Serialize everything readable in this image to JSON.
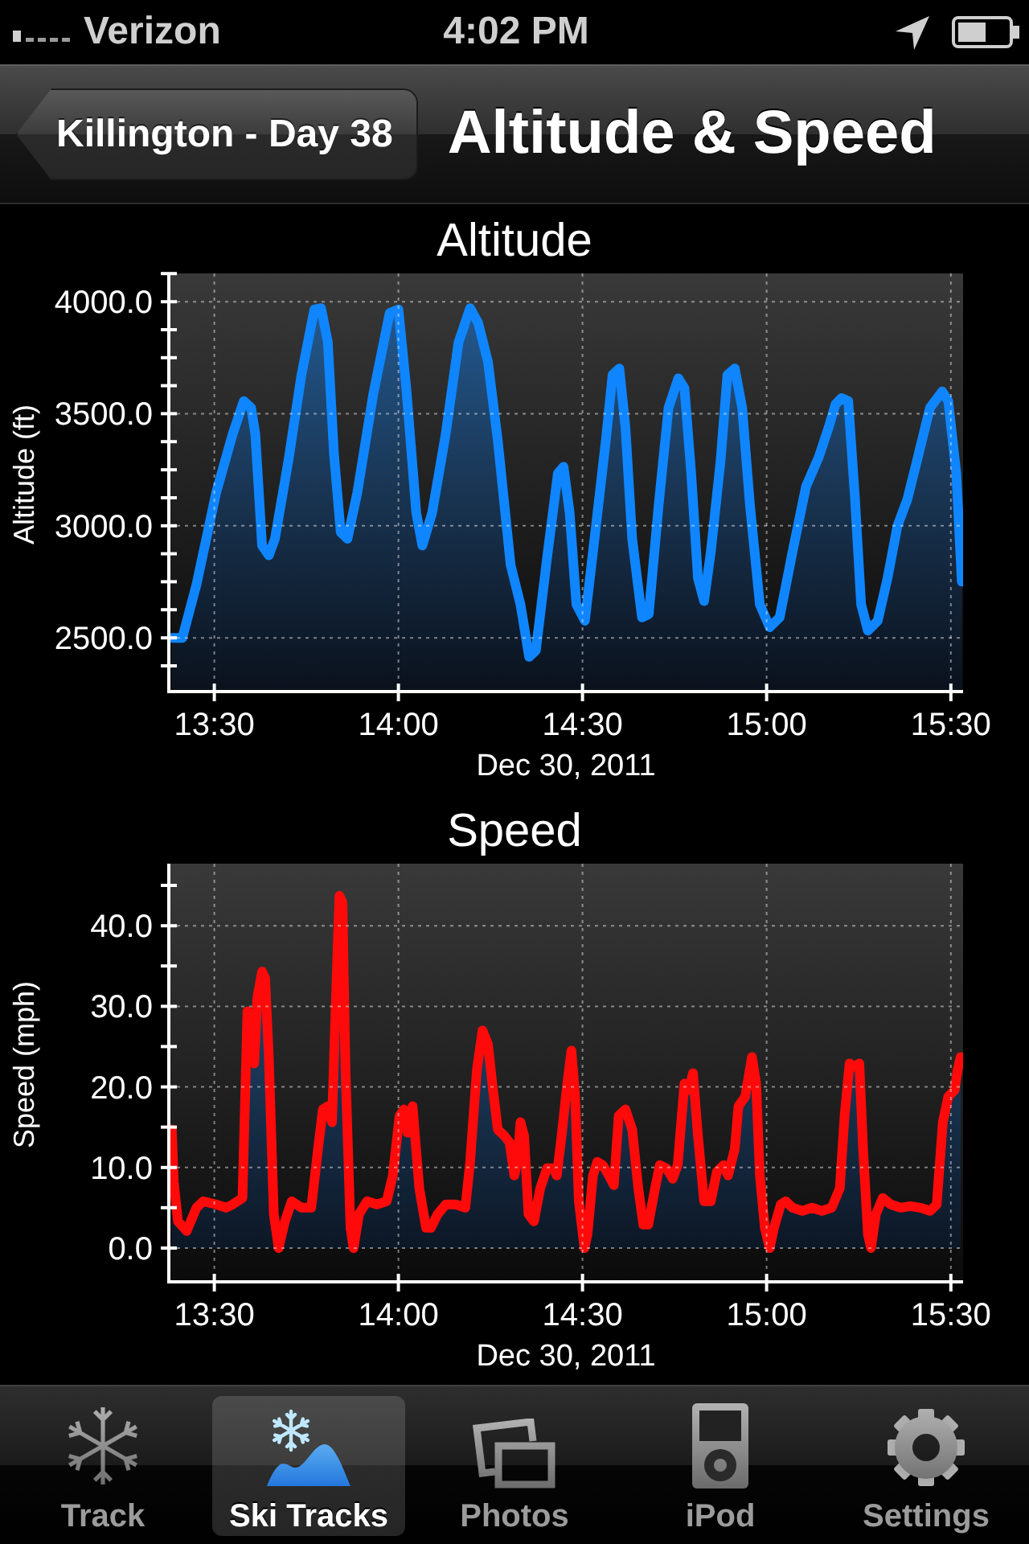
{
  "status_bar": {
    "carrier": "Verizon",
    "time": "4:02 PM"
  },
  "nav_bar": {
    "back_button": "Killington - Day 38",
    "title": "Altitude & Speed"
  },
  "charts": [
    {
      "chart_data": {
        "type": "area",
        "title": "Altitude",
        "xlabel": "Dec 30, 2011",
        "ylabel": "Altitude (ft)",
        "grid": true,
        "x": [
          803.1,
          804.8,
          807.1,
          810.3,
          813.0,
          814.8,
          816.0,
          816.7,
          817.8,
          818.9,
          819.9,
          822.1,
          824.2,
          826.3,
          827.4,
          828.5,
          829.5,
          830.6,
          831.7,
          833.3,
          835.9,
          838.6,
          840.0,
          841.3,
          842.9,
          843.9,
          845.5,
          847.7,
          849.8,
          851.7,
          853.0,
          854.6,
          856.2,
          858.3,
          859.9,
          861.3,
          862.4,
          864.2,
          866.0,
          866.9,
          867.9,
          869.0,
          870.4,
          871.7,
          873.8,
          874.9,
          876.0,
          877.0,
          878.1,
          879.7,
          880.8,
          882.4,
          884.0,
          885.6,
          886.6,
          887.7,
          888.8,
          889.8,
          890.9,
          892.5,
          893.6,
          894.8,
          896.0,
          897.3,
          898.9,
          900.5,
          902.1,
          904.2,
          906.4,
          908.5,
          910.1,
          911.2,
          912.2,
          913.3,
          914.4,
          915.4,
          916.5,
          918.1,
          919.7,
          921.3,
          922.9,
          924.5,
          926.6,
          928.6,
          929.6,
          930.9,
          931.8
        ],
        "series": [
          {
            "color": "#0f86ff",
            "values": [
              2500,
              2500,
              2737,
              3146,
              3409,
              3556,
              3526,
              3409,
              2912,
              2868,
              2942,
              3292,
              3673,
              3965,
              3971,
              3819,
              3322,
              2971,
              2942,
              3146,
              3585,
              3950,
              3965,
              3614,
              3058,
              2912,
              3058,
              3409,
              3819,
              3971,
              3906,
              3731,
              3380,
              2825,
              2649,
              2415,
              2444,
              2854,
              3234,
              3263,
              3058,
              2649,
              2576,
              2883,
              3380,
              3673,
              3702,
              3439,
              2942,
              2591,
              2605,
              3088,
              3526,
              3658,
              3614,
              3234,
              2766,
              2664,
              2883,
              3292,
              3673,
              3702,
              3526,
              3088,
              2649,
              2547,
              2591,
              2883,
              3175,
              3307,
              3439,
              3541,
              3570,
              3556,
              3117,
              2649,
              2532,
              2576,
              2766,
              3000,
              3117,
              3292,
              3526,
              3599,
              3556,
              3234,
              2751
            ]
          }
        ],
        "xlim": [
          802.6,
          932.0
        ],
        "ylim": [
          2260,
          4126
        ],
        "xticks": [
          {
            "value": 810,
            "label": "13:30"
          },
          {
            "value": 840,
            "label": "14:00"
          },
          {
            "value": 870,
            "label": "14:30"
          },
          {
            "value": 900,
            "label": "15:00"
          },
          {
            "value": 930,
            "label": "15:30"
          }
        ],
        "yticks": [
          {
            "value": 2500,
            "label": "2500.0"
          },
          {
            "value": 3000,
            "label": "3000.0"
          },
          {
            "value": 3500,
            "label": "3500.0"
          },
          {
            "value": 4000,
            "label": "4000.0"
          }
        ]
      }
    },
    {
      "chart_data": {
        "type": "area",
        "title": "Speed",
        "xlabel": "Dec 30, 2011",
        "ylabel": "Speed (mph)",
        "grid": true,
        "x": [
          803.1,
          803.4,
          804.1,
          805.5,
          807.1,
          808.2,
          810.3,
          811.9,
          813.0,
          814.6,
          815.4,
          816.0,
          816.5,
          817.0,
          817.8,
          818.3,
          818.9,
          819.7,
          820.5,
          821.5,
          822.6,
          824.2,
          825.8,
          826.9,
          827.7,
          828.5,
          829.2,
          829.8,
          830.4,
          830.9,
          831.4,
          832.2,
          832.7,
          833.6,
          834.9,
          836.5,
          838.1,
          839.1,
          840.2,
          840.9,
          841.5,
          842.3,
          843.4,
          844.5,
          845.3,
          846.4,
          847.7,
          849.3,
          850.9,
          851.7,
          852.8,
          853.7,
          854.6,
          855.3,
          856.2,
          857.3,
          858.1,
          858.9,
          859.4,
          859.9,
          860.5,
          861.2,
          862.1,
          863.1,
          864.2,
          865.3,
          865.8,
          866.6,
          867.5,
          868.2,
          868.8,
          869.4,
          870.3,
          870.8,
          871.7,
          872.4,
          873.3,
          874.3,
          875.1,
          875.9,
          877.0,
          878.1,
          879.1,
          879.9,
          880.7,
          881.8,
          882.6,
          883.7,
          884.7,
          885.5,
          886.6,
          887.3,
          888.0,
          888.8,
          889.8,
          890.9,
          891.9,
          893.0,
          893.7,
          894.8,
          895.4,
          896.5,
          897.6,
          898.3,
          898.9,
          899.7,
          900.5,
          901.2,
          902.3,
          903.1,
          904.2,
          905.8,
          907.4,
          909.0,
          910.6,
          911.9,
          912.7,
          913.5,
          914.3,
          915.1,
          915.7,
          916.5,
          917.0,
          917.8,
          918.9,
          920.2,
          921.8,
          923.4,
          925.0,
          926.6,
          927.7,
          928.7,
          929.6,
          930.6,
          931.1,
          931.6
        ],
        "series": [
          {
            "color": "#ff0a0a",
            "values": [
              14.7,
              8.2,
              3.3,
              2.1,
              5.0,
              5.8,
              5.4,
              5.0,
              5.4,
              6.2,
              29.4,
              27.8,
              22.9,
              31.0,
              34.3,
              33.5,
              23.7,
              4.2,
              0.0,
              3.3,
              5.8,
              5.0,
              5.0,
              12.3,
              17.2,
              17.6,
              15.6,
              30.2,
              43.7,
              42.9,
              22.1,
              2.5,
              0.0,
              4.2,
              5.8,
              5.4,
              5.8,
              9.0,
              16.4,
              17.2,
              14.3,
              17.6,
              7.4,
              2.5,
              2.5,
              4.2,
              5.4,
              5.4,
              5.0,
              10.7,
              22.1,
              27.0,
              25.3,
              20.4,
              14.7,
              13.9,
              13.1,
              9.0,
              10.7,
              15.6,
              13.9,
              4.2,
              3.3,
              7.4,
              9.9,
              9.9,
              9.0,
              13.9,
              20.4,
              24.5,
              18.8,
              5.8,
              0.0,
              1.7,
              9.0,
              10.7,
              10.3,
              9.0,
              7.8,
              16.4,
              17.2,
              14.7,
              7.4,
              2.9,
              2.9,
              7.4,
              10.3,
              9.9,
              8.6,
              10.3,
              20.4,
              19.6,
              21.7,
              13.9,
              5.8,
              5.8,
              9.5,
              10.3,
              9.0,
              12.3,
              17.6,
              18.8,
              23.7,
              20.4,
              9.0,
              2.5,
              0.0,
              2.5,
              5.4,
              5.8,
              5.0,
              4.6,
              5.0,
              4.6,
              5.0,
              7.4,
              16.4,
              22.9,
              22.5,
              22.9,
              12.3,
              1.7,
              0.0,
              4.2,
              6.2,
              5.4,
              5.0,
              5.2,
              5.0,
              4.6,
              5.4,
              15.6,
              18.8,
              19.6,
              22.1,
              23.7
            ]
          }
        ],
        "xlim": [
          802.6,
          932.0
        ],
        "ylim": [
          -4.2,
          47.7
        ],
        "xticks": [
          {
            "value": 810,
            "label": "13:30"
          },
          {
            "value": 840,
            "label": "14:00"
          },
          {
            "value": 870,
            "label": "14:30"
          },
          {
            "value": 900,
            "label": "15:00"
          },
          {
            "value": 930,
            "label": "15:30"
          }
        ],
        "yticks": [
          {
            "value": 0,
            "label": "0.0"
          },
          {
            "value": 10,
            "label": "10.0"
          },
          {
            "value": 20,
            "label": "20.0"
          },
          {
            "value": 30,
            "label": "30.0"
          },
          {
            "value": 40,
            "label": "40.0"
          }
        ]
      }
    }
  ],
  "tab_bar": {
    "tabs": [
      {
        "label": "Track",
        "selected": false
      },
      {
        "label": "Ski Tracks",
        "selected": true
      },
      {
        "label": "Photos",
        "selected": false
      },
      {
        "label": "iPod",
        "selected": false
      },
      {
        "label": "Settings",
        "selected": false
      }
    ]
  }
}
